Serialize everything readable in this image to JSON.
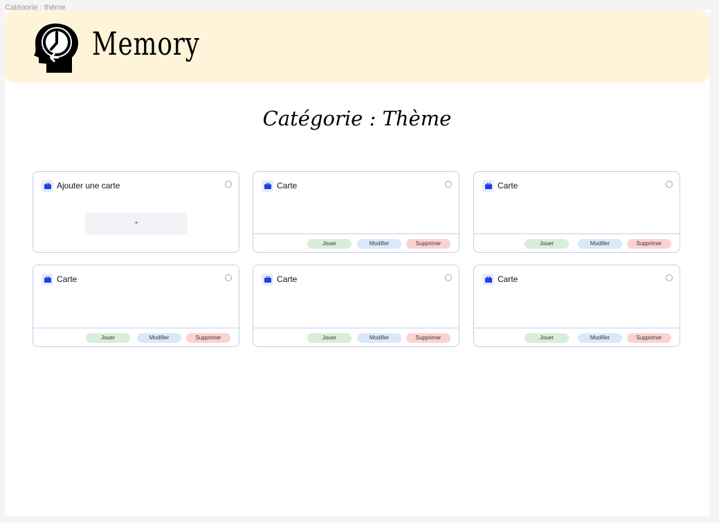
{
  "frame_label": "Catégorie : thème",
  "header": {
    "brand": "Memory",
    "logo_icon": "head-clock-icon"
  },
  "page_title": "Catégorie : Thème",
  "add_card": {
    "title": "Ajouter une carte",
    "add_label": "+"
  },
  "cards": [
    {
      "title": "Carte",
      "play": "Jouer",
      "edit": "Modifier",
      "delete": "Supprimer"
    },
    {
      "title": "Carte",
      "play": "Jouer",
      "edit": "Modifier",
      "delete": "Supprimer"
    },
    {
      "title": "Carte",
      "play": "Jouer",
      "edit": "Modifier",
      "delete": "Supprimer"
    },
    {
      "title": "Carte",
      "play": "Jouer",
      "edit": "Modifier",
      "delete": "Supprimer"
    },
    {
      "title": "Carte",
      "play": "Jouer",
      "edit": "Modifier",
      "delete": "Supprimer"
    }
  ],
  "colors": {
    "header_bg": "#fff4d9",
    "accent_icon": "#1d3fe0",
    "play": "#d9eed9",
    "edit": "#d9e9fb",
    "delete": "#fbd2d2"
  }
}
